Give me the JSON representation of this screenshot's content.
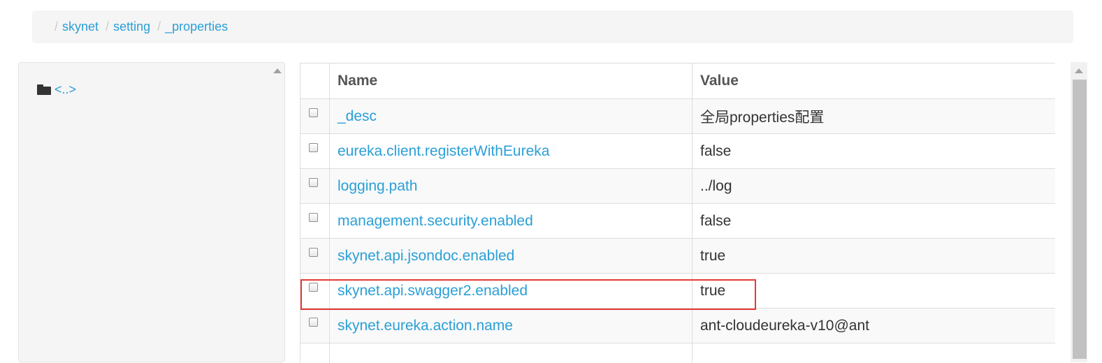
{
  "breadcrumb": {
    "separator": "/",
    "items": [
      "skynet",
      "setting",
      "_properties"
    ]
  },
  "tree": {
    "items": [
      {
        "icon": "folder-icon",
        "label": "<..>"
      }
    ]
  },
  "table": {
    "headers": {
      "select": "",
      "name": "Name",
      "value": "Value"
    },
    "rows": [
      {
        "name": "_desc",
        "value": "全局properties配置"
      },
      {
        "name": "eureka.client.registerWithEureka",
        "value": "false"
      },
      {
        "name": "logging.path",
        "value": "../log"
      },
      {
        "name": "management.security.enabled",
        "value": "false"
      },
      {
        "name": "skynet.api.jsondoc.enabled",
        "value": "true"
      },
      {
        "name": "skynet.api.swagger2.enabled",
        "value": "true"
      },
      {
        "name": "skynet.eureka.action.name",
        "value": "ant-cloudeureka-v10@ant"
      }
    ],
    "highlighted_row_index": 5
  },
  "colors": {
    "link": "#2a9fd6",
    "highlight_border": "#e53935",
    "breadcrumb_bg": "#f5f5f5"
  }
}
